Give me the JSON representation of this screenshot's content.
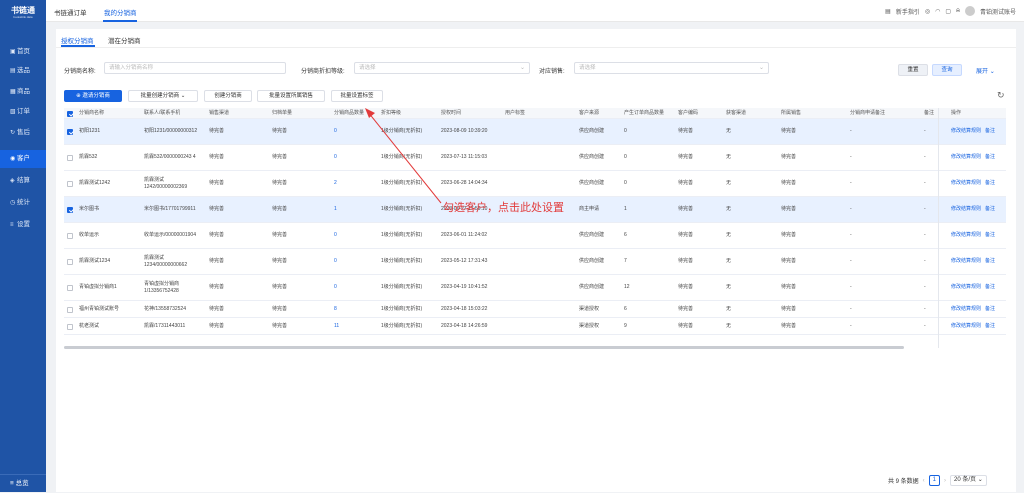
{
  "colors": {
    "primary": "#1763e0",
    "sidebar": "#1f54a6",
    "annotation": "#e23b3b"
  },
  "logo": {
    "title": "书链通",
    "subtitle": "bookslink data"
  },
  "sidebar": {
    "items": [
      {
        "icon": "home-icon",
        "glyph": "▣",
        "label": "首页"
      },
      {
        "icon": "product-icon",
        "glyph": "▤",
        "label": "选品"
      },
      {
        "icon": "goods-icon",
        "glyph": "▦",
        "label": "商品"
      },
      {
        "icon": "order-icon",
        "glyph": "▧",
        "label": "订单"
      },
      {
        "icon": "aftersale-icon",
        "glyph": "↻",
        "label": "售后"
      },
      {
        "icon": "customer-icon",
        "glyph": "◉",
        "label": "客户"
      },
      {
        "icon": "settle-icon",
        "glyph": "◈",
        "label": "结算"
      },
      {
        "icon": "stats-icon",
        "glyph": "◷",
        "label": "统计"
      },
      {
        "icon": "settings-icon",
        "glyph": "≡",
        "label": "设置"
      }
    ],
    "bottom": "总览"
  },
  "top_tabs": [
    "书链通订单",
    "我的分销商"
  ],
  "top_right": {
    "guide": "新手指引",
    "account": "青铂测试账号"
  },
  "sub_tabs": [
    "授权分销商",
    "潜在分销商"
  ],
  "filters": {
    "name_label": "分销商名称:",
    "name_placeholder": "请输入分销商名称",
    "level_label": "分销商折扣等级:",
    "level_placeholder": "请选择",
    "sales_label": "对应销售:",
    "sales_placeholder": "请选择",
    "reset": "重置",
    "query": "查询",
    "expand": "展开"
  },
  "actions": [
    "邀请分销商",
    "批量创建分销商",
    "创建分销商",
    "批量设置所属销售",
    "批量设置标签"
  ],
  "table": {
    "headers": [
      "分销商名称",
      "联系人/联系手机",
      "销售渠道",
      "归档单量",
      "分销商品数量",
      "折扣等级",
      "授权时间",
      "用户标签",
      "客户来源",
      "产生订单商品数量",
      "客户编码",
      "获客渠道",
      "所属销售",
      "分销商申请备注",
      "备注",
      "操作"
    ],
    "op_edit": "修改结算规则",
    "op_note": "备注",
    "rows": [
      {
        "sel": true,
        "name": "初阳1231",
        "contact": "初阳1231/00000000312",
        "channel": "待完善",
        "archive": "待完善",
        "count": "0",
        "level": "1级分销商(无折扣)",
        "time": "2023-08-09 10:39:20",
        "tag": "",
        "source": "供应商创建",
        "orders": "0",
        "code": "待完善",
        "acq": "无",
        "sales": "待完善",
        "apply": "-",
        "note": "-"
      },
      {
        "sel": false,
        "name": "凯霖532",
        "contact": "凯霖532/0000000243 4",
        "channel": "待完善",
        "archive": "待完善",
        "count": "0",
        "level": "1级分销商(无折扣)",
        "time": "2023-07-13 11:15:03",
        "tag": "",
        "source": "供应商创建",
        "orders": "0",
        "code": "待完善",
        "acq": "无",
        "sales": "待完善",
        "apply": "-",
        "note": "-"
      },
      {
        "sel": false,
        "name": "凯霖测试1242",
        "contact": "凯霖测试1242/00000002369",
        "channel": "待完善",
        "archive": "待完善",
        "count": "2",
        "level": "1级分销商(无折扣)",
        "time": "2023-06-28 14:04:34",
        "tag": "",
        "source": "供应商创建",
        "orders": "0",
        "code": "待完善",
        "acq": "无",
        "sales": "待完善",
        "apply": "-",
        "note": "-"
      },
      {
        "sel": true,
        "name": "米尔图书",
        "contact": "米尔图书/17701799911",
        "channel": "待完善",
        "archive": "待完善",
        "count": "1",
        "level": "1级分销商(无折扣)",
        "time": "2023-06-27 17:59:10",
        "tag": "",
        "source": "商主申请",
        "orders": "1",
        "code": "待完善",
        "acq": "无",
        "sales": "待完善",
        "apply": "-",
        "note": "-"
      },
      {
        "sel": false,
        "name": "收单运示",
        "contact": "收单运示/00000001904",
        "channel": "待完善",
        "archive": "待完善",
        "count": "0",
        "level": "1级分销商(无折扣)",
        "time": "2023-06-01 11:24:02",
        "tag": "",
        "source": "供应商创建",
        "orders": "6",
        "code": "待完善",
        "acq": "无",
        "sales": "待完善",
        "apply": "-",
        "note": "-"
      },
      {
        "sel": false,
        "name": "凯霖测试1234",
        "contact": "凯霖测试1234/00000000662",
        "channel": "待完善",
        "archive": "待完善",
        "count": "0",
        "level": "1级分销商(无折扣)",
        "time": "2023-05-12 17:31:43",
        "tag": "",
        "source": "供应商创建",
        "orders": "7",
        "code": "待完善",
        "acq": "无",
        "sales": "待完善",
        "apply": "-",
        "note": "-"
      },
      {
        "sel": false,
        "name": "青铂虚拟分销商1",
        "contact": "青铂虚拟分销商1/13356752428",
        "channel": "待完善",
        "archive": "待完善",
        "count": "0",
        "level": "1级分销商(无折扣)",
        "time": "2023-04-19 10:41:52",
        "tag": "",
        "source": "供应商创建",
        "orders": "12",
        "code": "待完善",
        "acq": "无",
        "sales": "待完善",
        "apply": "-",
        "note": "-"
      },
      {
        "sel": false,
        "name": "福州青铂测试账号",
        "contact": "花神/13558732524",
        "channel": "待完善",
        "archive": "待完善",
        "count": "8",
        "level": "1级分销商(无折扣)",
        "time": "2023-04-18 15:03:22",
        "tag": "",
        "source": "渠道授权",
        "orders": "6",
        "code": "待完善",
        "acq": "无",
        "sales": "待完善",
        "apply": "-",
        "note": "-"
      },
      {
        "sel": false,
        "name": "杭老测试",
        "contact": "凯霖/17311443011",
        "channel": "待完善",
        "archive": "待完善",
        "count": "11",
        "level": "1级分销商(无折扣)",
        "time": "2023-04-18 14:26:59",
        "tag": "",
        "source": "渠道授权",
        "orders": "9",
        "code": "待完善",
        "acq": "无",
        "sales": "待完善",
        "apply": "-",
        "note": "-"
      }
    ]
  },
  "pager": {
    "total": "共 9 条数据",
    "page": "1",
    "size": "20 条/页"
  },
  "annotation": "勾选客户，点击此处设置"
}
